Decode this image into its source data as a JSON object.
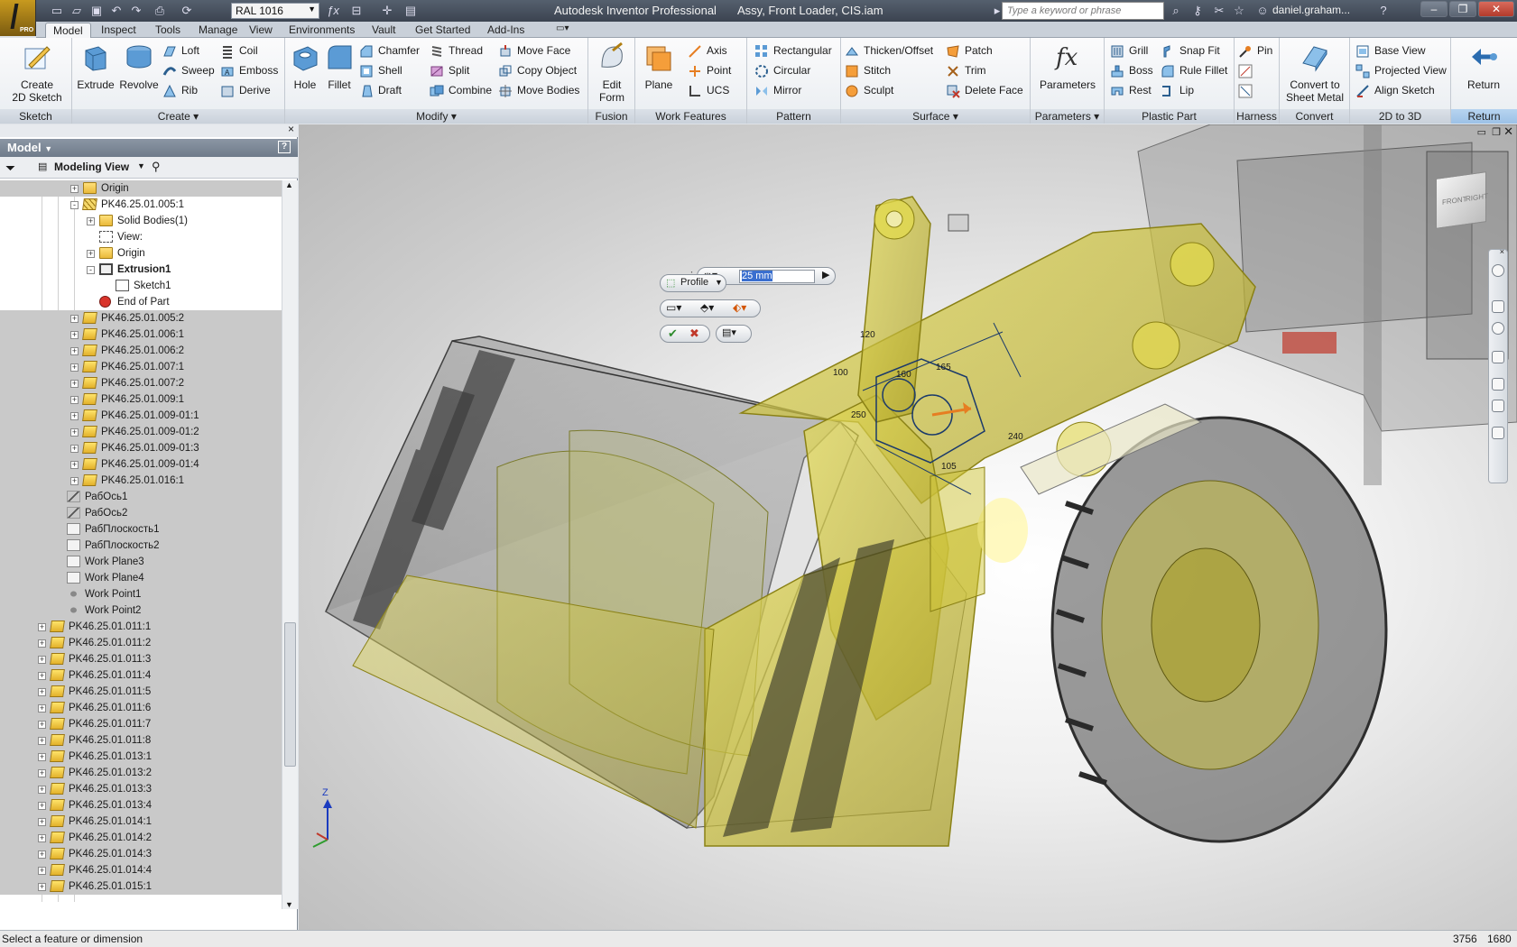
{
  "app": {
    "title": "Autodesk Inventor Professional",
    "document": "Assy, Front Loader, CIS.iam",
    "logo_text": "PRO"
  },
  "quick_access": {
    "color_style": "RAL 1016",
    "search_placeholder": "Type a keyword or phrase",
    "user": "daniel.graham..."
  },
  "tabs": [
    "Model",
    "Inspect",
    "Tools",
    "Manage",
    "View",
    "Environments",
    "Vault",
    "Get Started",
    "Add-Ins"
  ],
  "active_tab": "Model",
  "ribbon": {
    "sketch": {
      "label": "Sketch",
      "create_2d_sketch": "Create\n2D Sketch"
    },
    "create": {
      "label": "Create",
      "extrude": "Extrude",
      "revolve": "Revolve",
      "loft": "Loft",
      "sweep": "Sweep",
      "rib": "Rib",
      "coil": "Coil",
      "emboss": "Emboss",
      "derive": "Derive"
    },
    "modify": {
      "label": "Modify",
      "hole": "Hole",
      "fillet": "Fillet",
      "chamfer": "Chamfer",
      "shell": "Shell",
      "draft": "Draft",
      "thread": "Thread",
      "split": "Split",
      "combine": "Combine",
      "move_face": "Move Face",
      "copy_object": "Copy Object",
      "move_bodies": "Move Bodies"
    },
    "fusion": {
      "label": "Fusion",
      "edit_form": "Edit\nForm"
    },
    "work_features": {
      "label": "Work Features",
      "plane": "Plane",
      "axis": "Axis",
      "point": "Point",
      "ucs": "UCS"
    },
    "pattern": {
      "label": "Pattern",
      "rectangular": "Rectangular",
      "circular": "Circular",
      "mirror": "Mirror"
    },
    "surface": {
      "label": "Surface",
      "thicken_offset": "Thicken/Offset",
      "stitch": "Stitch",
      "sculpt": "Sculpt",
      "patch": "Patch",
      "trim": "Trim",
      "delete_face": "Delete Face"
    },
    "parameters": {
      "label": "Parameters",
      "parameters": "Parameters"
    },
    "plastic_part": {
      "label": "Plastic Part",
      "grill": "Grill",
      "boss": "Boss",
      "rest": "Rest",
      "snap_fit": "Snap Fit",
      "rule_fillet": "Rule Fillet",
      "lip": "Lip"
    },
    "harness": {
      "label": "Harness",
      "pin": "Pin"
    },
    "convert": {
      "label": "Convert",
      "convert_to_sheet_metal": "Convert to\nSheet Metal"
    },
    "twod_to_3d": {
      "label": "2D to 3D",
      "base_view": "Base View",
      "projected_view": "Projected View",
      "align_sketch": "Align Sketch"
    },
    "return": {
      "label": "Return",
      "return": "Return"
    }
  },
  "browser": {
    "header": "Model",
    "view": "Modeling View",
    "rows": [
      {
        "label": "Origin",
        "indent": 2,
        "icon": "folder",
        "expand": "+",
        "hl": true
      },
      {
        "label": "PK46.25.01.005:1",
        "indent": 2,
        "icon": "part-edit",
        "expand": "-",
        "hl": false
      },
      {
        "label": "Solid Bodies(1)",
        "indent": 3,
        "icon": "folder",
        "expand": "+",
        "hl": false
      },
      {
        "label": "View:",
        "indent": 3,
        "icon": "view",
        "expand": "",
        "hl": false
      },
      {
        "label": "Origin",
        "indent": 3,
        "icon": "folder",
        "expand": "+",
        "hl": false
      },
      {
        "label": "Extrusion1",
        "indent": 3,
        "icon": "extrude",
        "expand": "-",
        "hl": false,
        "bold": true
      },
      {
        "label": "Sketch1",
        "indent": 4,
        "icon": "sketch",
        "expand": "",
        "hl": false
      },
      {
        "label": "End of Part",
        "indent": 3,
        "icon": "eop",
        "expand": "",
        "hl": false
      },
      {
        "label": "PK46.25.01.005:2",
        "indent": 2,
        "icon": "part",
        "expand": "+",
        "hl": true
      },
      {
        "label": "PK46.25.01.006:1",
        "indent": 2,
        "icon": "part",
        "expand": "+",
        "hl": true
      },
      {
        "label": "PK46.25.01.006:2",
        "indent": 2,
        "icon": "part",
        "expand": "+",
        "hl": true
      },
      {
        "label": "PK46.25.01.007:1",
        "indent": 2,
        "icon": "part",
        "expand": "+",
        "hl": true
      },
      {
        "label": "PK46.25.01.007:2",
        "indent": 2,
        "icon": "part",
        "expand": "+",
        "hl": true
      },
      {
        "label": "PK46.25.01.009:1",
        "indent": 2,
        "icon": "part",
        "expand": "+",
        "hl": true
      },
      {
        "label": "PK46.25.01.009-01:1",
        "indent": 2,
        "icon": "part",
        "expand": "+",
        "hl": true
      },
      {
        "label": "PK46.25.01.009-01:2",
        "indent": 2,
        "icon": "part",
        "expand": "+",
        "hl": true
      },
      {
        "label": "PK46.25.01.009-01:3",
        "indent": 2,
        "icon": "part",
        "expand": "+",
        "hl": true
      },
      {
        "label": "PK46.25.01.009-01:4",
        "indent": 2,
        "icon": "part",
        "expand": "+",
        "hl": true
      },
      {
        "label": "PK46.25.01.016:1",
        "indent": 2,
        "icon": "part",
        "expand": "+",
        "hl": true
      },
      {
        "label": "РабОсь1",
        "indent": 1,
        "icon": "axis",
        "expand": "",
        "hl": true
      },
      {
        "label": "РабОсь2",
        "indent": 1,
        "icon": "axis",
        "expand": "",
        "hl": true
      },
      {
        "label": "РабПлоскость1",
        "indent": 1,
        "icon": "plane",
        "expand": "",
        "hl": true
      },
      {
        "label": "РабПлоскость2",
        "indent": 1,
        "icon": "plane",
        "expand": "",
        "hl": true
      },
      {
        "label": "Work Plane3",
        "indent": 1,
        "icon": "plane",
        "expand": "",
        "hl": true
      },
      {
        "label": "Work Plane4",
        "indent": 1,
        "icon": "plane",
        "expand": "",
        "hl": true
      },
      {
        "label": "Work Point1",
        "indent": 1,
        "icon": "point",
        "expand": "",
        "hl": true
      },
      {
        "label": "Work Point2",
        "indent": 1,
        "icon": "point",
        "expand": "",
        "hl": true
      },
      {
        "label": "PK46.25.01.011:1",
        "indent": 0,
        "icon": "part",
        "expand": "+",
        "hl": true
      },
      {
        "label": "PK46.25.01.011:2",
        "indent": 0,
        "icon": "part",
        "expand": "+",
        "hl": true
      },
      {
        "label": "PK46.25.01.011:3",
        "indent": 0,
        "icon": "part",
        "expand": "+",
        "hl": true
      },
      {
        "label": "PK46.25.01.011:4",
        "indent": 0,
        "icon": "part",
        "expand": "+",
        "hl": true
      },
      {
        "label": "PK46.25.01.011:5",
        "indent": 0,
        "icon": "part",
        "expand": "+",
        "hl": true
      },
      {
        "label": "PK46.25.01.011:6",
        "indent": 0,
        "icon": "part",
        "expand": "+",
        "hl": true
      },
      {
        "label": "PK46.25.01.011:7",
        "indent": 0,
        "icon": "part",
        "expand": "+",
        "hl": true
      },
      {
        "label": "PK46.25.01.011:8",
        "indent": 0,
        "icon": "part",
        "expand": "+",
        "hl": true
      },
      {
        "label": "PK46.25.01.013:1",
        "indent": 0,
        "icon": "part",
        "expand": "+",
        "hl": true
      },
      {
        "label": "PK46.25.01.013:2",
        "indent": 0,
        "icon": "part",
        "expand": "+",
        "hl": true
      },
      {
        "label": "PK46.25.01.013:3",
        "indent": 0,
        "icon": "part",
        "expand": "+",
        "hl": true
      },
      {
        "label": "PK46.25.01.013:4",
        "indent": 0,
        "icon": "part",
        "expand": "+",
        "hl": true
      },
      {
        "label": "PK46.25.01.014:1",
        "indent": 0,
        "icon": "part",
        "expand": "+",
        "hl": true
      },
      {
        "label": "PK46.25.01.014:2",
        "indent": 0,
        "icon": "part",
        "expand": "+",
        "hl": true
      },
      {
        "label": "PK46.25.01.014:3",
        "indent": 0,
        "icon": "part",
        "expand": "+",
        "hl": true
      },
      {
        "label": "PK46.25.01.014:4",
        "indent": 0,
        "icon": "part",
        "expand": "+",
        "hl": true
      },
      {
        "label": "PK46.25.01.015:1",
        "indent": 0,
        "icon": "part",
        "expand": "+",
        "hl": true
      }
    ]
  },
  "extrude_minitoolbar": {
    "distance": "25 mm",
    "profile": "Profile"
  },
  "sketch_dims": [
    "120",
    "100",
    "160",
    "165",
    "250",
    "105",
    "240"
  ],
  "viewcube": {
    "front": "FRONT",
    "right": "RIGHT"
  },
  "triad": {
    "z": "Z"
  },
  "status": {
    "message": "Select a feature or dimension",
    "count1": "3756",
    "count2": "1680"
  },
  "colors": {
    "accent": "#c9a227",
    "selection": "#e4e000",
    "model_yellow": "#d6cf3a"
  }
}
